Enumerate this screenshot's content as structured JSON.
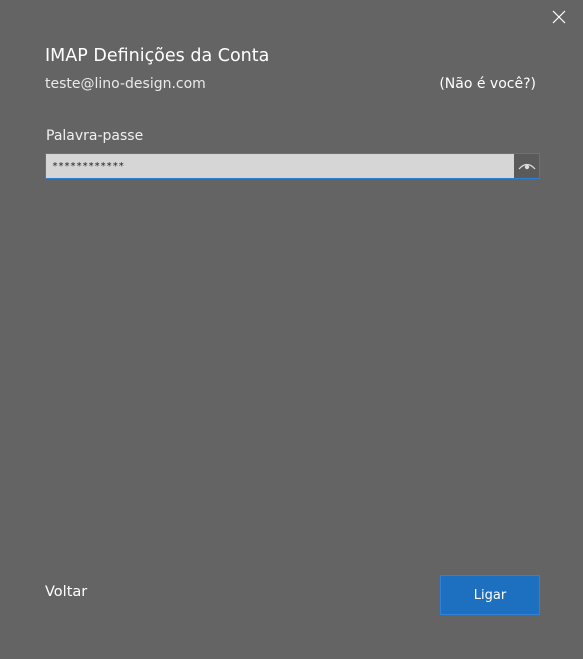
{
  "dialog": {
    "title": "IMAP Definições da Conta",
    "email": "teste@lino-design.com",
    "not_you_link": "(Não é você?)",
    "close_icon": "close-icon"
  },
  "password": {
    "label": "Palavra-passe",
    "value": "************",
    "reveal_icon": "eye-icon"
  },
  "footer": {
    "back_label": "Voltar",
    "connect_label": "Ligar"
  },
  "colors": {
    "background": "#646464",
    "accent": "#1d6fc0",
    "focus_border": "#2b7fd4",
    "input_bg": "#d6d6d6"
  }
}
